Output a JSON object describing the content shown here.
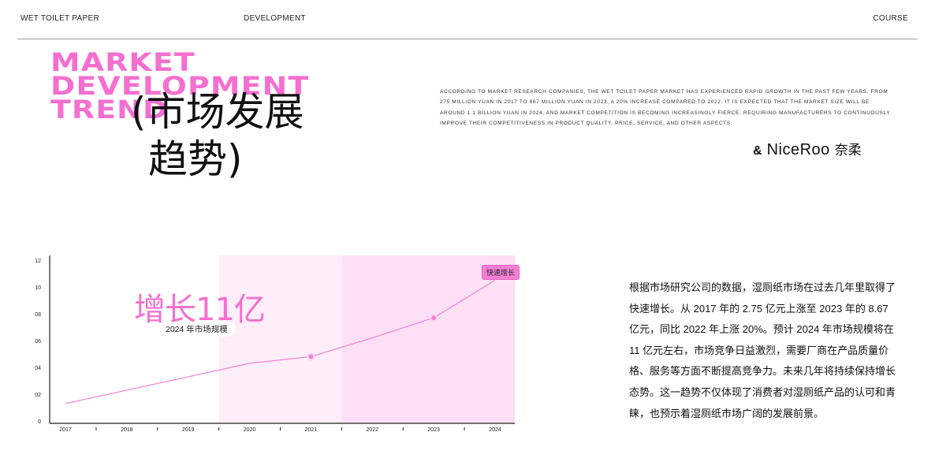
{
  "nav": {
    "left": "WET TOILET PAPER",
    "middle": "DEVELOPMENT",
    "right": "COURSE"
  },
  "title": {
    "en_lines": [
      "MARKET",
      "DEVELOPMENT",
      "TREND"
    ],
    "cn_line1": "(市场发展",
    "cn_line2": "趋势)"
  },
  "intro_en": "According to market research companies, the wet toilet paper market has experienced rapid growth in the past few years. From 275 million yuan in 2017 to 867 million yuan in 2023, a 20% increase compared to 2022. It is expected that the market size will be around 1.1 billion yuan in 2024, and market competition is becoming increasingly fierce, requiring manufacturers to continuously improve their competitiveness in product quality, price, service, and other aspects.",
  "brand": {
    "amp": "&",
    "name": "NiceRoo",
    "cn": "奈柔"
  },
  "callout": {
    "big": "增长11亿",
    "pill": "2024 年市场规模",
    "tag": "快速增长"
  },
  "body_cn": "根据市场研究公司的数据，湿厕纸市场在过去几年里取得了快速增长。从 2017 年的 2.75 亿元上涨至 2023 年的 8.67 亿元，同比 2022 年上涨 20%。预计 2024 年市场规模将在 11 亿元左右，市场竞争日益激烈，需要厂商在产品质量价格、服务等方面不断提高竞争力。未来几年将持续保持增长态势。这一趋势不仅体现了消费者对湿厕纸产品的认可和青睐，也预示着湿厕纸市场广阔的发展前景。",
  "colors": {
    "accent": "#f46fd0",
    "line": "#f27fd6",
    "band_light": "#fdeef9",
    "band_dark": "#fde0f5"
  },
  "chart_data": {
    "type": "line",
    "categories": [
      "2017",
      "2018",
      "2019",
      "2020",
      "2021",
      "2022",
      "2023",
      "2024"
    ],
    "y_ticks": [
      "0",
      "02",
      "04",
      "06",
      "08",
      "10",
      "12"
    ],
    "ylim": [
      0,
      12
    ],
    "series": [
      {
        "values": [
          1.3,
          2.3,
          3.3,
          4.3,
          4.8,
          6.2,
          7.7,
          10.5
        ]
      }
    ],
    "markers": [
      {
        "x": "2021",
        "y": 4.8
      },
      {
        "x": "2023",
        "y": 7.7
      }
    ],
    "bands": [
      {
        "from": "2019",
        "to": "2021",
        "shade": "light"
      },
      {
        "from": "2021",
        "to": "2024",
        "shade": "dark"
      }
    ]
  }
}
